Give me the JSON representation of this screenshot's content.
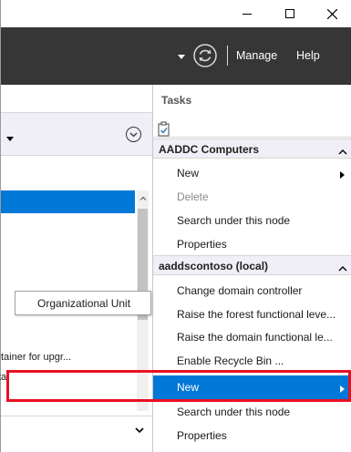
{
  "window": {
    "buttons": [
      "minimize",
      "maximize",
      "close"
    ]
  },
  "header": {
    "manage_label": "Manage",
    "help_label": "Help",
    "refresh_icon": "refresh-icon"
  },
  "left_pane": {
    "text_1": "tainer for upgr...",
    "text_2": "ta"
  },
  "context_menu": {
    "item_label": "Organizational Unit"
  },
  "tasks": {
    "title": "Tasks",
    "groups": [
      {
        "label": "AADDC Computers",
        "items": [
          {
            "label": "New",
            "has_submenu": true,
            "disabled": false
          },
          {
            "label": "Delete",
            "disabled": true
          },
          {
            "label": "Search under this node",
            "disabled": false
          },
          {
            "label": "Properties",
            "disabled": false
          }
        ]
      },
      {
        "label": "aaddscontoso (local)",
        "items": [
          {
            "label": "Change domain controller"
          },
          {
            "label": "Raise the forest functional leve..."
          },
          {
            "label": "Raise the domain functional le..."
          },
          {
            "label": "Enable Recycle Bin ..."
          },
          {
            "label": "New",
            "has_submenu": true,
            "highlighted": true
          },
          {
            "label": "Search under this node"
          },
          {
            "label": "Properties"
          }
        ]
      }
    ]
  },
  "colors": {
    "header_bg": "#363636",
    "selection": "#0078d7",
    "highlight_border": "#e81123",
    "group_bg": "#f0eef6"
  }
}
